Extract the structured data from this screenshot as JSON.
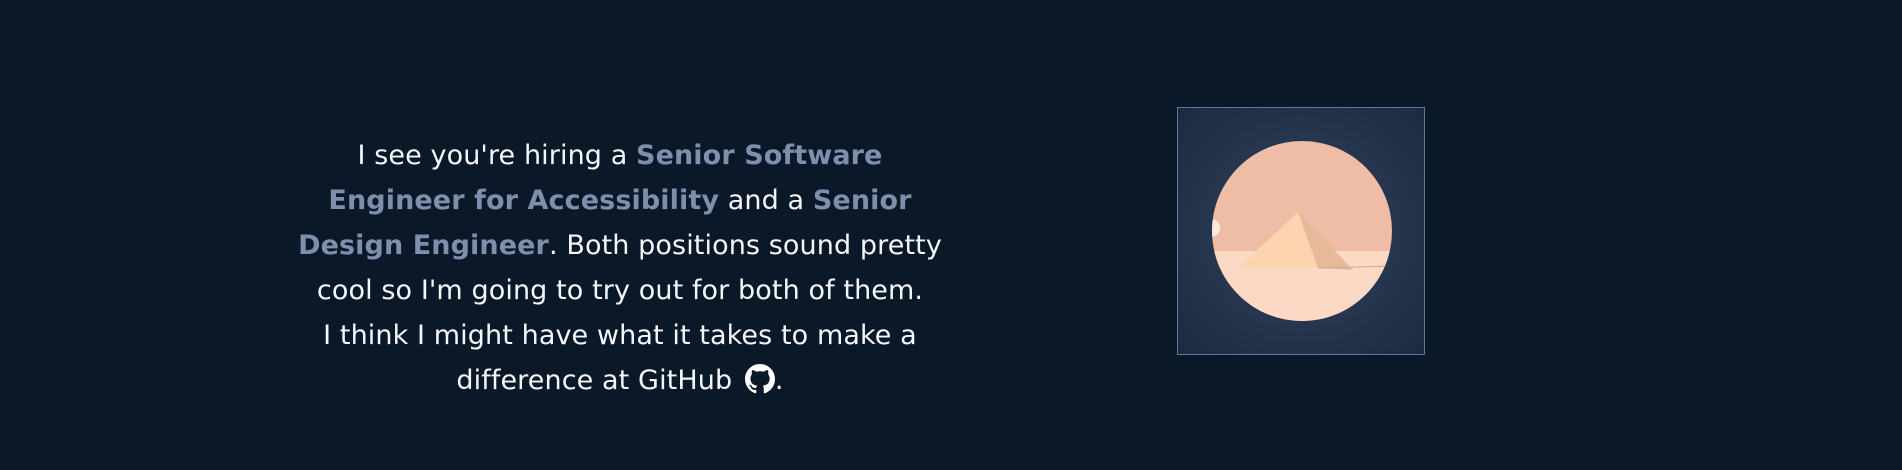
{
  "intro": {
    "part1": "I see you're hiring a ",
    "role1": "Senior Software Engineer for Accessibility",
    "part2": " and a ",
    "role2": "Senior Design Engineer",
    "part3": ". Both positions sound pretty cool so I'm going to try out for both of them.",
    "part4": "I think I might have what it takes to make a difference at GitHub",
    "part5": ".",
    "icon": "github-icon"
  },
  "illustration": {
    "icon": "pyramid-desert-illustration"
  },
  "colors": {
    "background": "#0b1828",
    "text": "#f4f6fa",
    "highlight": "#7e8fae",
    "frame_border": "#5b7a98",
    "sky": "#efbca5",
    "sand": "#fcd9c5"
  }
}
